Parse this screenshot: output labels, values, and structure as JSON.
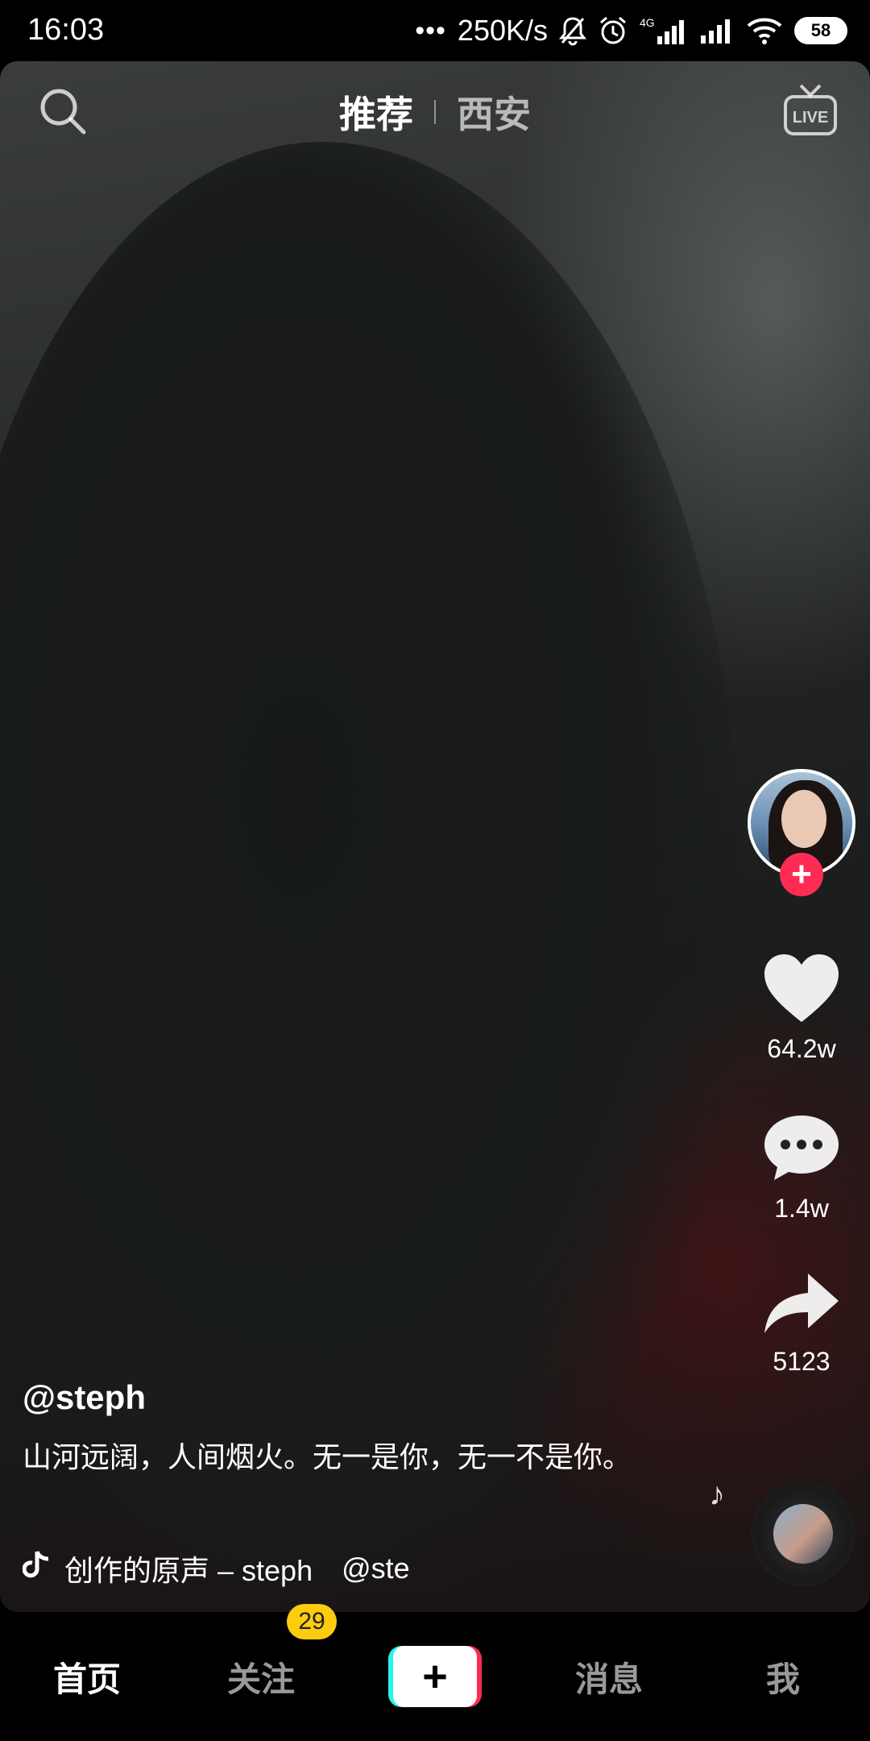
{
  "status_bar": {
    "time": "16:03",
    "dots": "•••",
    "net_speed": "250K/s",
    "network_type": "4G",
    "battery": "58"
  },
  "top_tabs": {
    "recommended": "推荐",
    "local": "西安",
    "live": "LIVE"
  },
  "video": {
    "author": "@steph",
    "caption": "山河远阔，人间烟火。无一是你，无一不是你。",
    "music_title": "创作的原声 – steph",
    "music_mention": "@ste"
  },
  "actions": {
    "likes": "64.2w",
    "comments": "1.4w",
    "shares": "5123",
    "follow_symbol": "+"
  },
  "bottom_nav": {
    "home": "首页",
    "following": "关注",
    "following_badge": "29",
    "create_symbol": "+",
    "messages": "消息",
    "me": "我"
  },
  "colors": {
    "accent_red": "#fe2c55",
    "accent_cyan": "#25f4ee",
    "badge_yellow": "#fccc0e"
  }
}
